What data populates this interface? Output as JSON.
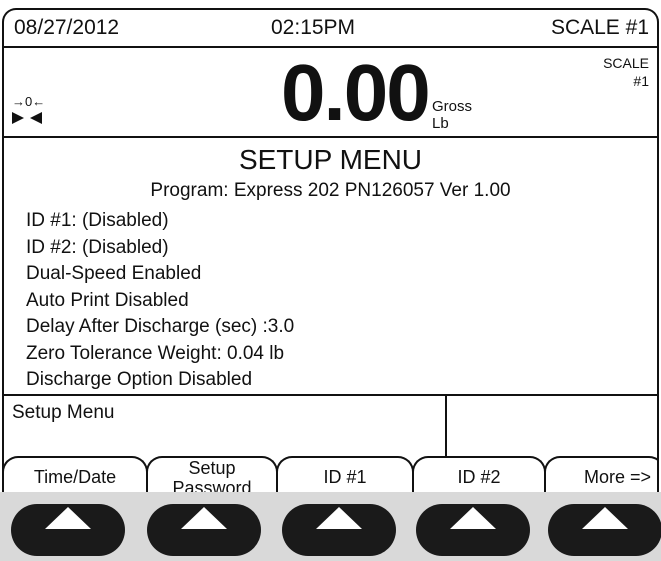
{
  "header": {
    "date": "08/27/2012",
    "time": "02:15PM",
    "scale": "SCALE #1"
  },
  "weight": {
    "zero_indicator": "→0←",
    "value": "0.00",
    "mode": "Gross",
    "unit": "Lb",
    "scale_line1": "SCALE",
    "scale_line2": "#1"
  },
  "setup": {
    "title": "SETUP MENU",
    "program": "Program: Express 202 PN126057 Ver 1.00",
    "lines": [
      "ID #1: (Disabled)",
      "ID #2: (Disabled)",
      "Dual-Speed Enabled",
      "Auto Print Disabled",
      "Delay After Discharge (sec) :3.0",
      "Zero Tolerance Weight: 0.04 lb",
      "Discharge Option Disabled"
    ]
  },
  "message": {
    "label": "Setup Menu"
  },
  "softkeys": {
    "time_date": "Time/Date",
    "setup_password_line1": "Setup",
    "setup_password_line2": "Password",
    "id1": "ID #1",
    "id2": "ID #2",
    "more": "More =>"
  },
  "hardware_buttons": {
    "count": 5,
    "icon": "up-triangle-icon"
  }
}
